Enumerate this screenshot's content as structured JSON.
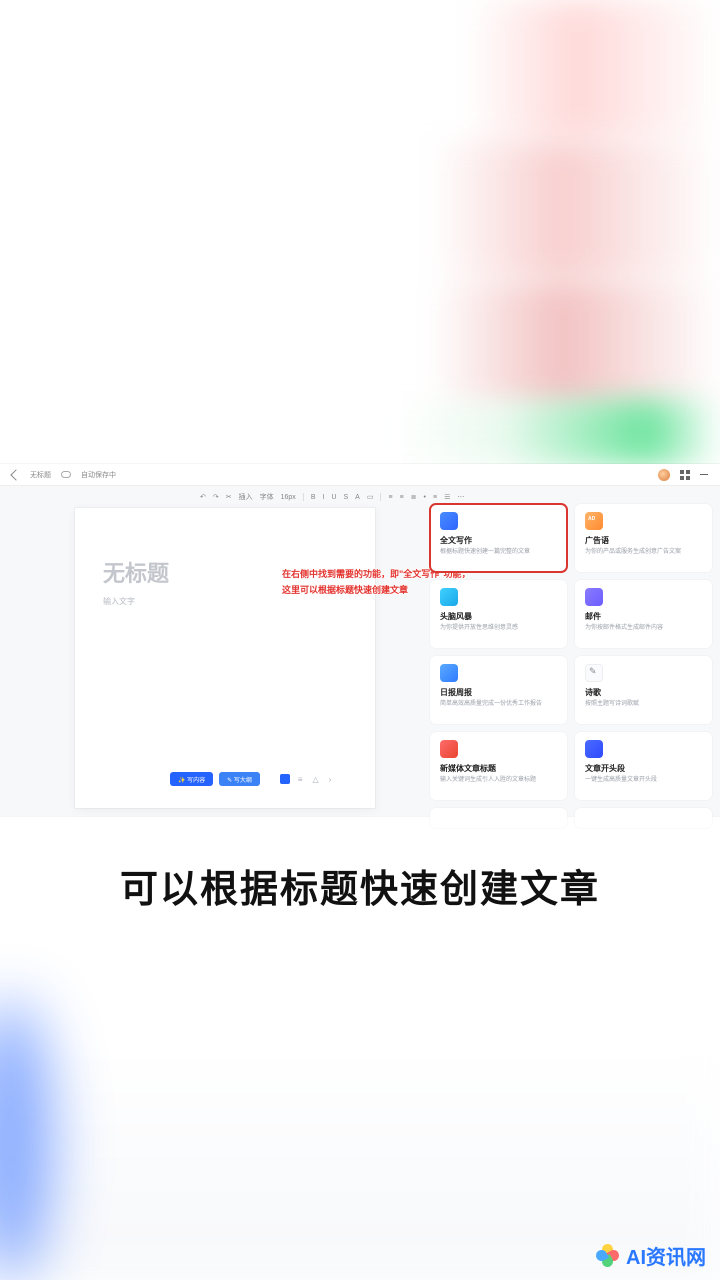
{
  "topbar": {
    "doc_label": "无标题",
    "save_status": "自动保存中"
  },
  "toolbar": {
    "items": [
      "↶",
      "↷",
      "✂",
      "插入",
      "字体",
      "16px",
      "B",
      "I",
      "U",
      "S",
      "A",
      "▭",
      "≡",
      "≡",
      "≣",
      "•",
      "≡",
      "☰",
      "⋯"
    ]
  },
  "document": {
    "title_placeholder": "无标题",
    "body_placeholder": "输入文字"
  },
  "annotation": {
    "line1": "在右侧中找到需要的功能，即\"全文写作\"功能，",
    "line2": "这里可以根据标题快速创建文章"
  },
  "docbar": {
    "btn1": "✨ 写内容",
    "btn2": "✎ 写大纲"
  },
  "cards": [
    {
      "id": "full-writing",
      "icon": "ic-blue",
      "title": "全文写作",
      "desc": "根据标题快速创建一篇完整的文章",
      "highlight": true
    },
    {
      "id": "ad-copy",
      "icon": "ic-orange",
      "title": "广告语",
      "desc": "为你的产品或服务生成创意广告文案"
    },
    {
      "id": "brainstorm",
      "icon": "ic-cyan",
      "title": "头脑风暴",
      "desc": "为你提供开放性思维创意灵感"
    },
    {
      "id": "email",
      "icon": "ic-purple",
      "title": "邮件",
      "desc": "为你按邮件格式生成邮件内容"
    },
    {
      "id": "report",
      "icon": "ic-blue2",
      "title": "日报周报",
      "desc": "简单高效高质量完成一份优秀工作报告"
    },
    {
      "id": "poetry",
      "icon": "ic-white",
      "title": "诗歌",
      "desc": "按照主题写诗词歌赋"
    },
    {
      "id": "media-title",
      "icon": "ic-red",
      "title": "新媒体文章标题",
      "desc": "输入关键词生成引人入胜的文章标题"
    },
    {
      "id": "paragraph",
      "icon": "ic-navy",
      "title": "文章开头段",
      "desc": "一键生成高质量文章开头段"
    },
    {
      "id": "extra1",
      "icon": "ic-red2",
      "title": "",
      "desc": ""
    },
    {
      "id": "extra2",
      "icon": "ic-red2",
      "title": "",
      "desc": ""
    }
  ],
  "caption": "可以根据标题快速创建文章",
  "watermark": "AI资讯网"
}
